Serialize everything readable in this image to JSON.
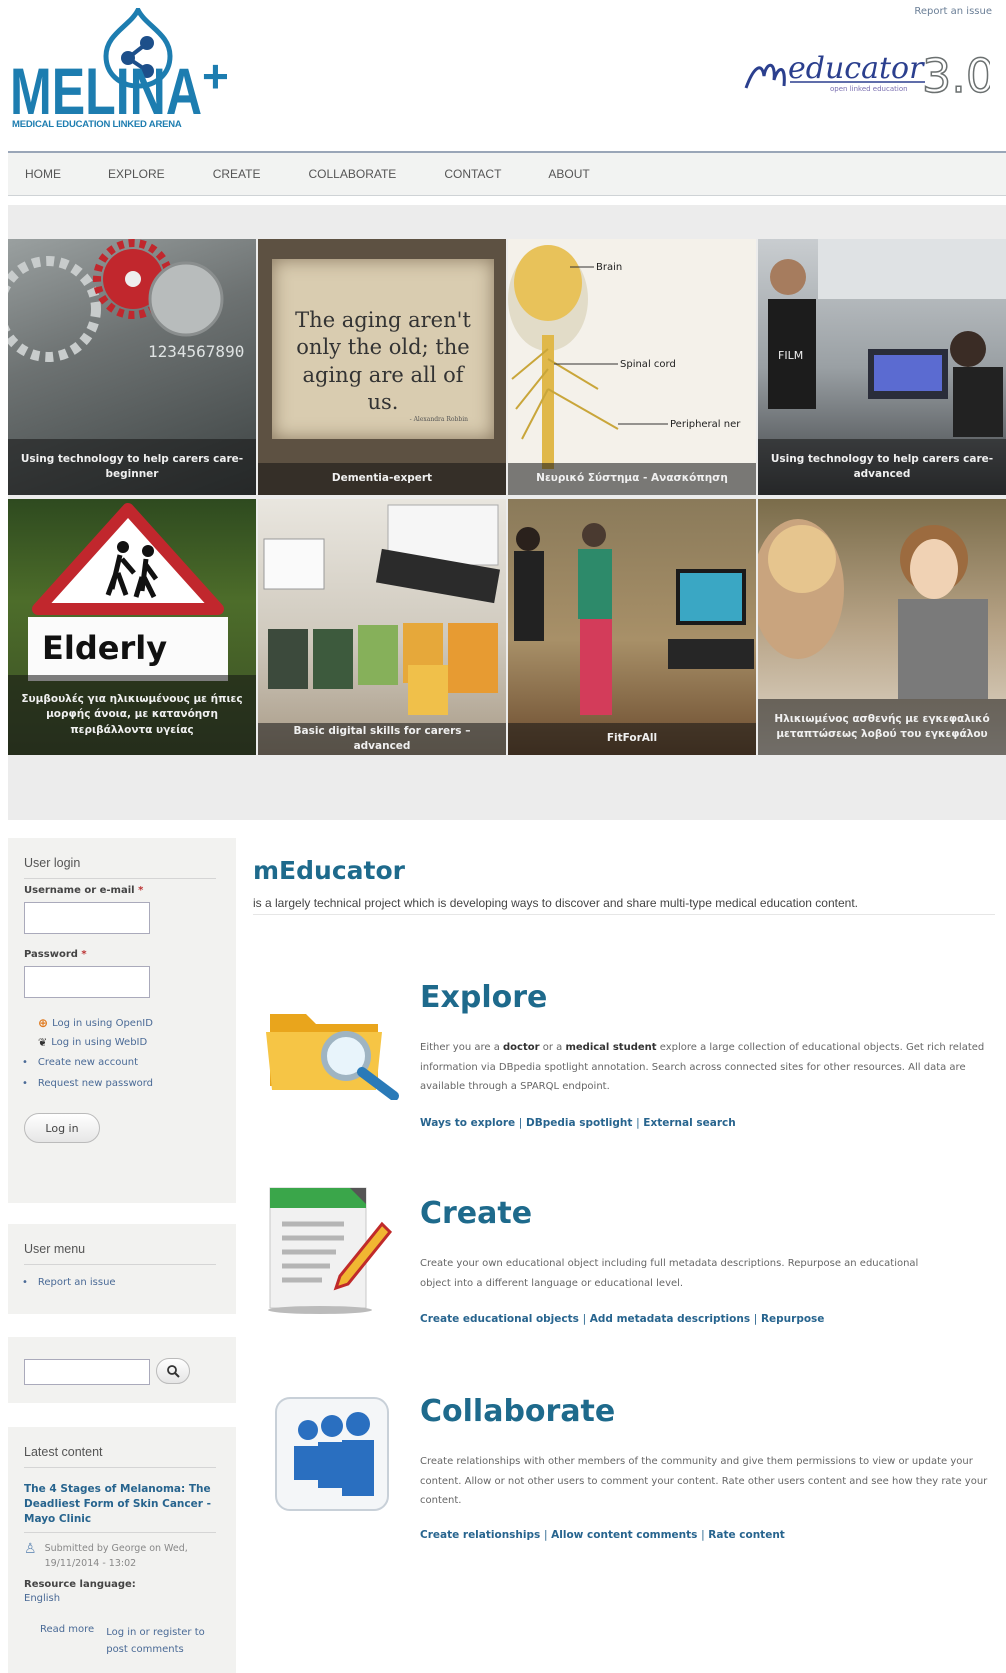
{
  "header": {
    "report_issue": "Report an issue",
    "logo_text": "MELINA",
    "logo_plus": "+",
    "logo_subtitle": "MEDICAL EDUCATION LINKED ARENA",
    "meducator_text": "educator",
    "meducator_version": "3.0",
    "meducator_tagline": "open linked education"
  },
  "nav": {
    "items": [
      "HOME",
      "EXPLORE",
      "CREATE",
      "COLLABORATE",
      "CONTACT",
      "ABOUT"
    ]
  },
  "gallery": {
    "tiles": [
      {
        "caption": "Using technology to help carers care-beginner"
      },
      {
        "caption": "Dementia-expert",
        "image_text": "The aging aren't only the old; the aging are all of us.",
        "image_credit": "- Alexandra Robbin"
      },
      {
        "caption": "Νευρικό Σύστημα - Ανασκόπηση",
        "labels": [
          "Brain",
          "Spinal cord",
          "Peripheral ner"
        ]
      },
      {
        "caption": "Using technology to help carers care-advanced",
        "image_text": "FILM"
      },
      {
        "caption": "Συμβουλές για ηλικιωμένους με ήπιες μορφής άνοια, με κατανόηση περιβάλλοντα υγείας",
        "image_text": "Elderly"
      },
      {
        "caption": "Basic digital skills for carers – advanced"
      },
      {
        "caption": "FitForAll"
      },
      {
        "caption": "Ηλικιωμένος ασθενής με εγκεφαλικό μεταπτώσεως λοβού του εγκεφάλου"
      }
    ]
  },
  "sidebar": {
    "login": {
      "title": "User login",
      "username_label": "Username or e-mail",
      "password_label": "Password",
      "required_mark": "*",
      "openid_link": "Log in using OpenID",
      "webid_link": "Log in using WebID",
      "create_account": "Create new account",
      "request_password": "Request new password",
      "login_button": "Log in"
    },
    "user_menu": {
      "title": "User menu",
      "report_issue": "Report an issue"
    },
    "latest": {
      "title": "Latest content",
      "item_title": "The 4 Stages of Melanoma: The Deadliest Form of Skin Cancer - Mayo Clinic",
      "submitted": "Submitted by George on Wed, 19/11/2014 - 13:02",
      "resource_language_label": "Resource language:",
      "resource_language": "English",
      "read_more": "Read more",
      "login_register": "Log in or register to post comments"
    }
  },
  "main": {
    "title": "mEducator",
    "intro": "is a largely technical project which is developing ways to discover and share multi-type medical education content.",
    "explore": {
      "heading": "Explore",
      "desc_1": "Either you are a ",
      "desc_doctor": "doctor",
      "desc_2": " or a ",
      "desc_student": "medical student",
      "desc_3": " explore a large collection of educational objects. Get rich related information via DBpedia spotlight annotation. Search across connected sites for other resources. All data are available through a SPARQL endpoint.",
      "links": [
        "Ways to explore",
        "DBpedia spotlight",
        "External search"
      ]
    },
    "create": {
      "heading": "Create",
      "desc": "Create your own educational object including full metadata descriptions. Repurpose an educational object into a different language or educational level.",
      "links": [
        "Create educational objects",
        "Add metadata descriptions",
        "Repurpose"
      ]
    },
    "collaborate": {
      "heading": "Collaborate",
      "desc": "Create relationships with other members of the community and give them permissions to view or update your content. Allow or not other users to comment your content. Rate other users content and see how they rate your content.",
      "links": [
        "Create relationships",
        "Allow content comments",
        "Rate content"
      ]
    },
    "link_separator": "|"
  },
  "colors": {
    "brand_blue": "#1d7db0",
    "heading_blue": "#1e6a8c",
    "link_blue": "#27648e",
    "sidebar_bg": "#f2f2f0",
    "nav_bg": "#f2f3f2"
  }
}
